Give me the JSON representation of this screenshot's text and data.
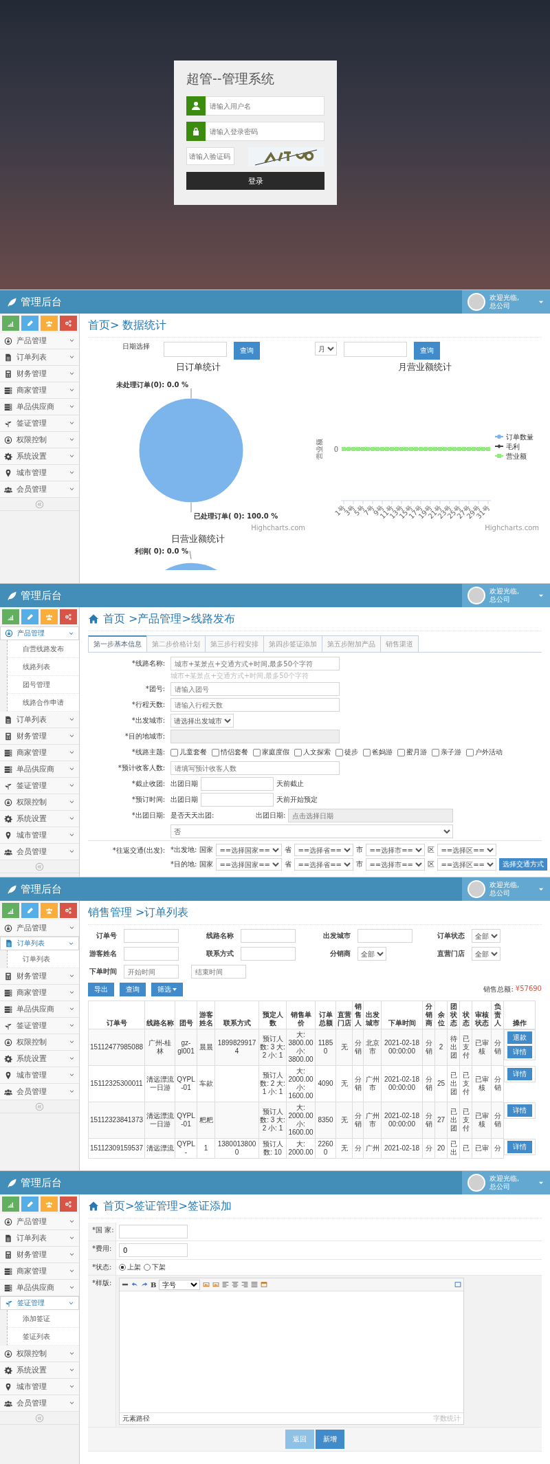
{
  "login": {
    "title": "超管--管理系统",
    "username": {
      "placeholder": "请输入用户名"
    },
    "password": {
      "placeholder": "请输入登录密码"
    },
    "captcha": {
      "placeholder": "请输入验证码"
    },
    "submit": "登录"
  },
  "screens": [
    {
      "kind": "stats",
      "header": {
        "brand": "管理后台",
        "welcome": "欢迎光临,",
        "company": "总公司"
      },
      "sidebar": {
        "shortcuts": [
          {
            "kind": "chart",
            "color": "#62b05f"
          },
          {
            "kind": "pencil",
            "color": "#56aee6"
          },
          {
            "kind": "group",
            "color": "#f9ae3b"
          },
          {
            "kind": "cogs",
            "color": "#d75447"
          }
        ],
        "items": [
          {
            "kind": "lock",
            "label": "产品管理",
            "selected": false,
            "expanded": false
          },
          {
            "kind": "file",
            "label": "订单列表",
            "selected": false,
            "expanded": false
          },
          {
            "kind": "building",
            "label": "财务管理",
            "selected": false,
            "expanded": false
          },
          {
            "kind": "server",
            "label": "商家管理",
            "selected": false,
            "expanded": false
          },
          {
            "kind": "server",
            "label": "单品供应商",
            "selected": false,
            "expanded": false
          },
          {
            "kind": "leaf",
            "label": "签证管理",
            "selected": false,
            "expanded": false
          },
          {
            "kind": "lock",
            "label": "权限控制",
            "selected": false,
            "expanded": false
          },
          {
            "kind": "gear",
            "label": "系统设置",
            "selected": false,
            "expanded": false
          },
          {
            "kind": "pin",
            "label": "城市管理",
            "selected": false,
            "expanded": false
          },
          {
            "kind": "users",
            "label": "会员管理",
            "selected": false,
            "expanded": false
          }
        ]
      },
      "page": {
        "breadcrumb": "首页> 数据统计",
        "date_label": "日期选择",
        "query_button": "查询",
        "period": "月",
        "query_button_2": "查询",
        "daily_orders": {
          "chart_data": {
            "type": "pie",
            "title": "日订单统计",
            "categories": [
              "未处理订单(0): 0.0 %",
              "已处理订单( 0): 100.0 %"
            ],
            "values": [
              0,
              100
            ]
          },
          "credit": "Highcharts.com"
        },
        "monthly_revenue": {
          "title": "月营业额统计",
          "ylabel": "营业额",
          "ytick": "0",
          "xticks": [
            "1号",
            "3号",
            "5号",
            "7号",
            "9号",
            "11号",
            "13号",
            "15号",
            "17号",
            "19号",
            "21号",
            "23号",
            "25号",
            "27号",
            "29号",
            "31号"
          ],
          "legend": [
            {
              "name": "订单数量",
              "color": "#7cb5ec"
            },
            {
              "name": "毛利",
              "color": "#434348"
            },
            {
              "name": "营业额",
              "color": "#90ed7d"
            }
          ],
          "credit": "Highcharts.com"
        },
        "daily_revenue": {
          "title": "日营业额统计",
          "label": "利润( 0): 0.0 %"
        }
      }
    },
    {
      "kind": "product",
      "header": {
        "brand": "管理后台",
        "welcome": "欢迎光临,",
        "company": "总公司"
      },
      "sidebar": {
        "shortcuts": [
          {
            "kind": "chart",
            "color": "#62b05f"
          },
          {
            "kind": "pencil",
            "color": "#56aee6"
          },
          {
            "kind": "group",
            "color": "#f9ae3b"
          },
          {
            "kind": "cogs",
            "color": "#d75447"
          }
        ],
        "items": [
          {
            "kind": "lock",
            "label": "产品管理",
            "selected": true,
            "expanded": true,
            "children": [
              {
                "label": "自营线路发布",
                "selected": false
              },
              {
                "label": "线路列表",
                "selected": false
              },
              {
                "label": "团号管理",
                "selected": false
              },
              {
                "label": "线路合作申请",
                "selected": false
              }
            ]
          },
          {
            "kind": "file",
            "label": "订单列表",
            "selected": false,
            "expanded": false
          },
          {
            "kind": "building",
            "label": "财务管理",
            "selected": false,
            "expanded": false
          },
          {
            "kind": "server",
            "label": "商家管理",
            "selected": false,
            "expanded": false
          },
          {
            "kind": "server",
            "label": "单品供应商",
            "selected": false,
            "expanded": false
          },
          {
            "kind": "leaf",
            "label": "签证管理",
            "selected": false,
            "expanded": false
          },
          {
            "kind": "lock",
            "label": "权限控制",
            "selected": false,
            "expanded": false
          },
          {
            "kind": "gear",
            "label": "系统设置",
            "selected": false,
            "expanded": false
          },
          {
            "kind": "pin",
            "label": "城市管理",
            "selected": false,
            "expanded": false
          },
          {
            "kind": "users",
            "label": "会员管理",
            "selected": false,
            "expanded": false
          }
        ]
      },
      "page": {
        "breadcrumb": "首页 >产品管理>线路发布",
        "tabs": [
          {
            "label": "第一步基本信息",
            "selected": true
          },
          {
            "label": "第二步价格计划",
            "selected": false
          },
          {
            "label": "第三步行程安排",
            "selected": false
          },
          {
            "label": "第四步签证添加",
            "selected": false
          },
          {
            "label": "第五步附加产品",
            "selected": false
          },
          {
            "label": "销售渠道",
            "selected": false
          }
        ],
        "fields": [
          {
            "kind": "text",
            "label": "*线路名称:",
            "placeholder": "城市+某景点+交通方式+时间,最多50个字符",
            "hint": "城市+某景点+交通方式+时间,最多50个字符"
          },
          {
            "kind": "text",
            "label": "*团号:",
            "placeholder": "请输入团号"
          },
          {
            "kind": "text",
            "label": "*行程天数:",
            "placeholder": "请输入行程天数"
          },
          {
            "kind": "select",
            "label": "*出发城市:",
            "value": "请选择出发城市"
          },
          {
            "kind": "disabled",
            "label": "*目的地城市:"
          },
          {
            "kind": "checks",
            "label": "*线路主题:",
            "options": [
              {
                "label": "儿童套餐",
                "checked": false
              },
              {
                "label": "情侣套餐",
                "checked": false
              },
              {
                "label": "家庭度假",
                "checked": false
              },
              {
                "label": "人文探索",
                "checked": false
              },
              {
                "label": "徒步",
                "checked": false
              },
              {
                "label": "爸妈游",
                "checked": false
              },
              {
                "label": "蜜月游",
                "checked": false
              },
              {
                "label": "亲子游",
                "checked": false
              },
              {
                "label": "户外活动",
                "checked": false
              }
            ]
          },
          {
            "kind": "text",
            "label": "*预计收客人数:",
            "placeholder": "请填写预计收客人数"
          },
          {
            "kind": "days",
            "label": "*截止收团:",
            "prefix": "出团日期",
            "suffix": "天前截止"
          },
          {
            "kind": "days",
            "label": "*预订时间:",
            "prefix": "出团日期",
            "suffix": "天前开始预定"
          },
          {
            "kind": "departure",
            "label": "*出团日期:",
            "daily_label": "是否天天出团:",
            "daily_value": "否",
            "date_label": "出团日期:",
            "date_placeholder": "点击选择日期"
          }
        ],
        "transport": {
          "label": "*往返交通(出发):",
          "rows": [
            {
              "label": "*出发地:",
              "country_label": "国家",
              "country": "==选择国家==",
              "province_label": "省",
              "province": "==选择省==",
              "city_label": "市",
              "city": "==选择市==",
              "district_label": "区",
              "district": "==选择区=="
            },
            {
              "label": "*目的地:",
              "country_label": "国家",
              "country": "==选择国家==",
              "province_label": "省",
              "province": "==选择省==",
              "city_label": "市",
              "city": "==选择市==",
              "district_label": "区",
              "district": "==选择区=="
            }
          ],
          "button": "选择交通方式"
        }
      }
    },
    {
      "kind": "orders",
      "header": {
        "brand": "管理后台",
        "welcome": "欢迎光临,",
        "company": "总公司"
      },
      "sidebar": {
        "shortcuts": [
          {
            "kind": "chart",
            "color": "#62b05f"
          },
          {
            "kind": "pencil",
            "color": "#56aee6"
          },
          {
            "kind": "group",
            "color": "#f9ae3b"
          },
          {
            "kind": "cogs",
            "color": "#d75447"
          }
        ],
        "items": [
          {
            "kind": "lock",
            "label": "产品管理",
            "selected": false,
            "expanded": false
          },
          {
            "kind": "file",
            "label": "订单列表",
            "selected": true,
            "expanded": true,
            "children": [
              {
                "label": "订单列表",
                "selected": false
              }
            ]
          },
          {
            "kind": "building",
            "label": "财务管理",
            "selected": false,
            "expanded": false
          },
          {
            "kind": "server",
            "label": "商家管理",
            "selected": false,
            "expanded": false
          },
          {
            "kind": "server",
            "label": "单品供应商",
            "selected": false,
            "expanded": false
          },
          {
            "kind": "leaf",
            "label": "签证管理",
            "selected": false,
            "expanded": false
          },
          {
            "kind": "lock",
            "label": "权限控制",
            "selected": false,
            "expanded": false
          },
          {
            "kind": "gear",
            "label": "系统设置",
            "selected": false,
            "expanded": false
          },
          {
            "kind": "pin",
            "label": "城市管理",
            "selected": false,
            "expanded": false
          },
          {
            "kind": "users",
            "label": "会员管理",
            "selected": false,
            "expanded": false
          }
        ]
      },
      "page": {
        "breadcrumb": "销售管理 >订单列表",
        "filters": [
          {
            "kind": "input",
            "label": "订单号"
          },
          {
            "kind": "input",
            "label": "线路名称"
          },
          {
            "kind": "input",
            "label": "出发城市"
          },
          {
            "kind": "select",
            "label": "订单状态",
            "value": "全部"
          },
          {
            "kind": "input",
            "label": "游客姓名"
          },
          {
            "kind": "input",
            "label": "联系方式"
          },
          {
            "kind": "select",
            "label": "分销商",
            "value": "全部"
          },
          {
            "kind": "select",
            "label": "直营门店",
            "value": "全部"
          }
        ],
        "date_filter": {
          "label": "下单时间",
          "start_placeholder": "开始时间",
          "end_placeholder": "结束时间"
        },
        "buttons": [
          {
            "label": "导出",
            "caret": false
          },
          {
            "label": "查询",
            "caret": false
          },
          {
            "label": "筛选",
            "caret": true
          }
        ],
        "total_label": "销售总额:",
        "total_value": "¥57690",
        "table": {
          "columns": [
            "订单号",
            "线路名称",
            "团号",
            "游客姓名",
            "联系方式",
            "预定人数",
            "销售单价",
            "订单总额",
            "直营门店",
            "销售人",
            "出发城市",
            "下单时间",
            "分销商",
            "余位",
            "团状态",
            "状态",
            "审核状态",
            "负责人",
            "操作"
          ],
          "rows": [
            {
              "cells": [
                "15112477985088",
                "广州-桂林",
                "gz-gl001",
                "晨晨",
                "18998299174",
                "预订人数: 3 大: 2 小: 1",
                "大: 3800.00 小: 3800.00",
                "11850",
                "无",
                "分销",
                "北京市",
                "2021-02-18 00:00:00",
                "分销",
                "2",
                "待出团",
                "已支付",
                "已审核",
                "分销"
              ],
              "actions": [
                "退款",
                "详情"
              ]
            },
            {
              "cells": [
                "15112325300011",
                "清远漂流一日游",
                "QYPL-01",
                "车款",
                "",
                "预订人数: 2 大: 1 小: 1",
                "大: 2000.00 小: 1600.00",
                "4090",
                "无",
                "分销",
                "广州市",
                "2021-02-18 00:00:00",
                "分销",
                "25",
                "已出团",
                "已支付",
                "已审核",
                "分销"
              ],
              "actions": [
                "详情"
              ]
            },
            {
              "cells": [
                "15112323841373",
                "清远漂流一日游",
                "QYPL-01",
                "粑粑",
                "",
                "预订人数: 3 大: 2 小: 1",
                "大: 2000.00 小: 1600.00",
                "8350",
                "无",
                "分销",
                "广州市",
                "2021-02-18 00:00:00",
                "分销",
                "27",
                "已出团",
                "已支付",
                "已审核",
                "分销"
              ],
              "actions": [
                "详情"
              ]
            },
            {
              "cells": [
                "15112309159537",
                "清远漂流",
                "QYPL-",
                "1",
                "13800138000",
                "预订人数: 10",
                "大: 2000.00",
                "22600",
                "无",
                "分",
                "广州",
                "2021-02-18",
                "分",
                "20",
                "已出",
                "已",
                "已审",
                "分"
              ],
              "actions": [
                "详情"
              ]
            }
          ]
        }
      }
    },
    {
      "kind": "visa",
      "header": {
        "brand": "管理后台",
        "welcome": "欢迎光临,",
        "company": "总公司"
      },
      "sidebar": {
        "shortcuts": [
          {
            "kind": "chart",
            "color": "#62b05f"
          },
          {
            "kind": "pencil",
            "color": "#56aee6"
          },
          {
            "kind": "group",
            "color": "#f9ae3b"
          },
          {
            "kind": "cogs",
            "color": "#d75447"
          }
        ],
        "items": [
          {
            "kind": "lock",
            "label": "产品管理",
            "selected": false,
            "expanded": false
          },
          {
            "kind": "file",
            "label": "订单列表",
            "selected": false,
            "expanded": false
          },
          {
            "kind": "building",
            "label": "财务管理",
            "selected": false,
            "expanded": false
          },
          {
            "kind": "server",
            "label": "商家管理",
            "selected": false,
            "expanded": false
          },
          {
            "kind": "server",
            "label": "单品供应商",
            "selected": false,
            "expanded": false
          },
          {
            "kind": "leaf",
            "label": "签证管理",
            "selected": true,
            "expanded": true,
            "children": [
              {
                "label": "添加签证",
                "selected": false
              },
              {
                "label": "签证列表",
                "selected": false
              }
            ]
          },
          {
            "kind": "lock",
            "label": "权限控制",
            "selected": false,
            "expanded": false
          },
          {
            "kind": "gear",
            "label": "系统设置",
            "selected": false,
            "expanded": false
          },
          {
            "kind": "pin",
            "label": "城市管理",
            "selected": false,
            "expanded": false
          },
          {
            "kind": "users",
            "label": "会员管理",
            "selected": false,
            "expanded": false
          }
        ]
      },
      "page": {
        "breadcrumb": "首页>签证管理>签证添加",
        "fields": [
          {
            "kind": "input",
            "label": "*国 家:"
          },
          {
            "kind": "input",
            "label": "*费用:",
            "value": "0"
          },
          {
            "kind": "radio",
            "label": "*状态:",
            "options": [
              {
                "label": "上架",
                "selected": true
              },
              {
                "label": "下架",
                "selected": false
              }
            ]
          },
          {
            "kind": "editor",
            "label": "*样版:",
            "bold": "B",
            "font_size": "字号",
            "path_label": "元素路径",
            "word_count": "字数统计"
          }
        ],
        "buttons": [
          {
            "kind": "secondary",
            "label": "返回"
          },
          {
            "kind": "primary",
            "label": "新增"
          }
        ]
      }
    }
  ]
}
